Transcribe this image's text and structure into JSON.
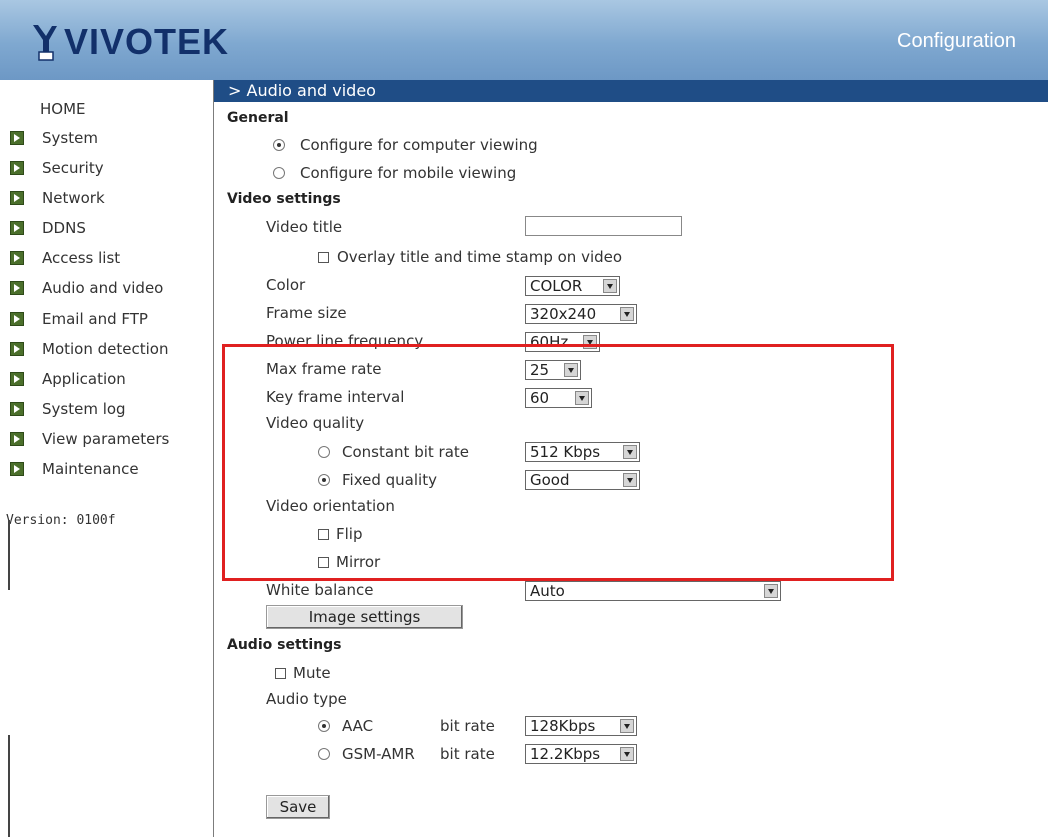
{
  "header": {
    "brand": "VIVOTEK",
    "title": "Configuration"
  },
  "sidebar": {
    "home": "HOME",
    "items": [
      {
        "label": "System"
      },
      {
        "label": "Security"
      },
      {
        "label": "Network"
      },
      {
        "label": "DDNS"
      },
      {
        "label": "Access list"
      },
      {
        "label": "Audio and video"
      },
      {
        "label": "Email and FTP"
      },
      {
        "label": "Motion detection"
      },
      {
        "label": "Application"
      },
      {
        "label": "System log"
      },
      {
        "label": "View parameters"
      },
      {
        "label": "Maintenance"
      }
    ],
    "version": "Version: 0100f"
  },
  "section": {
    "title": "> Audio and video"
  },
  "general": {
    "heading": "General",
    "computer_label": "Configure for computer viewing",
    "mobile_label": "Configure for mobile viewing",
    "selected": "computer"
  },
  "video": {
    "heading": "Video settings",
    "title_label": "Video title",
    "title_value": "",
    "overlay_label": "Overlay title and time stamp on video",
    "color_label": "Color",
    "color_value": "COLOR",
    "frame_size_label": "Frame size",
    "frame_size_value": "320x240",
    "power_label": "Power line frequency",
    "power_value": "60Hz",
    "max_rate_label": "Max frame rate",
    "max_rate_value": "25",
    "key_interval_label": "Key frame interval",
    "key_interval_value": "60",
    "quality_label": "Video quality",
    "constant_label": "Constant bit rate",
    "constant_value": "512 Kbps",
    "fixed_label": "Fixed quality",
    "fixed_value": "Good",
    "quality_selected": "fixed",
    "orientation_label": "Video orientation",
    "flip_label": "Flip",
    "mirror_label": "Mirror",
    "white_balance_label": "White balance",
    "white_balance_value": "Auto",
    "image_settings_button": "Image settings"
  },
  "audio": {
    "heading": "Audio settings",
    "mute_label": "Mute",
    "type_label": "Audio type",
    "aac_label": "AAC",
    "gsm_label": "GSM-AMR",
    "bitrate_label": "bit rate",
    "aac_bitrate": "128Kbps",
    "gsm_bitrate": "12.2Kbps",
    "selected": "aac"
  },
  "save_button": "Save",
  "colors": {
    "header": "#7fa8d0",
    "section_bar": "#1f4d86",
    "highlight": "#e02020"
  }
}
